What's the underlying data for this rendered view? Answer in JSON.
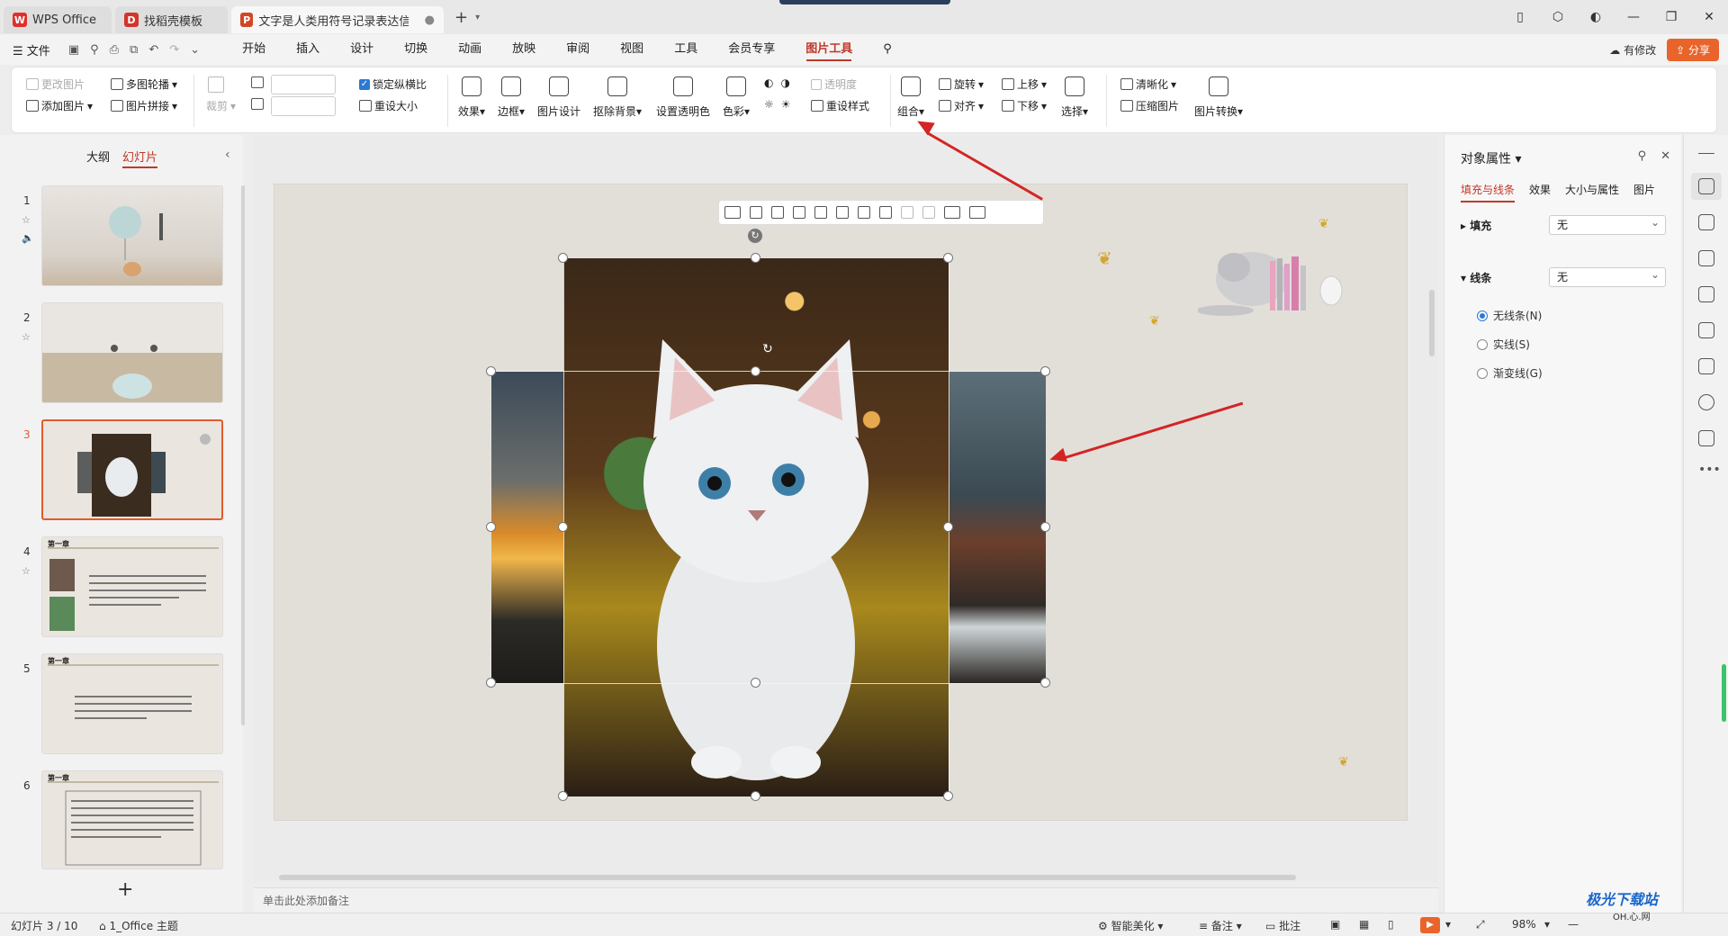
{
  "tabs": [
    {
      "label": "WPS Office"
    },
    {
      "label": "找稻壳模板"
    },
    {
      "label": "文字是人类用符号记录表达信息以"
    }
  ],
  "menu": {
    "file": "文件",
    "tabs": [
      "开始",
      "插入",
      "设计",
      "切换",
      "动画",
      "放映",
      "审阅",
      "视图",
      "工具",
      "会员专享",
      "图片工具"
    ],
    "active_tab": "图片工具",
    "modified": "有修改",
    "share": "分享"
  },
  "ribbon": {
    "change_picture": "更改图片",
    "multi_carousel": "多图轮播",
    "add_picture": "添加图片",
    "picture_collage": "图片拼接",
    "crop": "裁剪",
    "lock_ratio": "锁定纵横比",
    "resize": "重设大小",
    "effect": "效果",
    "border": "边框",
    "picture_design": "图片设计",
    "remove_bg": "抠除背景",
    "set_transparent": "设置透明色",
    "color": "色彩",
    "transparency": "透明度",
    "reset_style": "重设样式",
    "group": "组合",
    "rotate": "旋转",
    "align": "对齐",
    "bring_up": "上移",
    "send_down": "下移",
    "select": "选择",
    "sharpen": "清晰化",
    "compress": "压缩图片",
    "convert": "图片转换"
  },
  "left_panel": {
    "tab_outline": "大纲",
    "tab_slides": "幻灯片",
    "slides": [
      {
        "num": "1"
      },
      {
        "num": "2"
      },
      {
        "num": "3"
      },
      {
        "num": "4"
      },
      {
        "num": "5"
      },
      {
        "num": "6"
      }
    ],
    "slide_heading": "第一章"
  },
  "notes_placeholder": "单击此处添加备注",
  "right_panel": {
    "title": "对象属性",
    "tabs": [
      "填充与线条",
      "效果",
      "大小与属性",
      "图片"
    ],
    "fill_label": "填充",
    "fill_value": "无",
    "line_label": "线条",
    "line_value": "无",
    "radio": [
      "无线条(N)",
      "实线(S)",
      "渐变线(G)"
    ]
  },
  "status": {
    "slide_count": "幻灯片 3 / 10",
    "theme": "1_Office 主题",
    "beautify": "智能美化",
    "notes": "备注",
    "comments": "批注",
    "zoom": "98%"
  },
  "watermark": {
    "text": "极光下载站",
    "sub": "OH.心.网"
  },
  "colors": {
    "accent": "#c0392b",
    "share": "#e9642a",
    "arrow": "#d42424"
  }
}
